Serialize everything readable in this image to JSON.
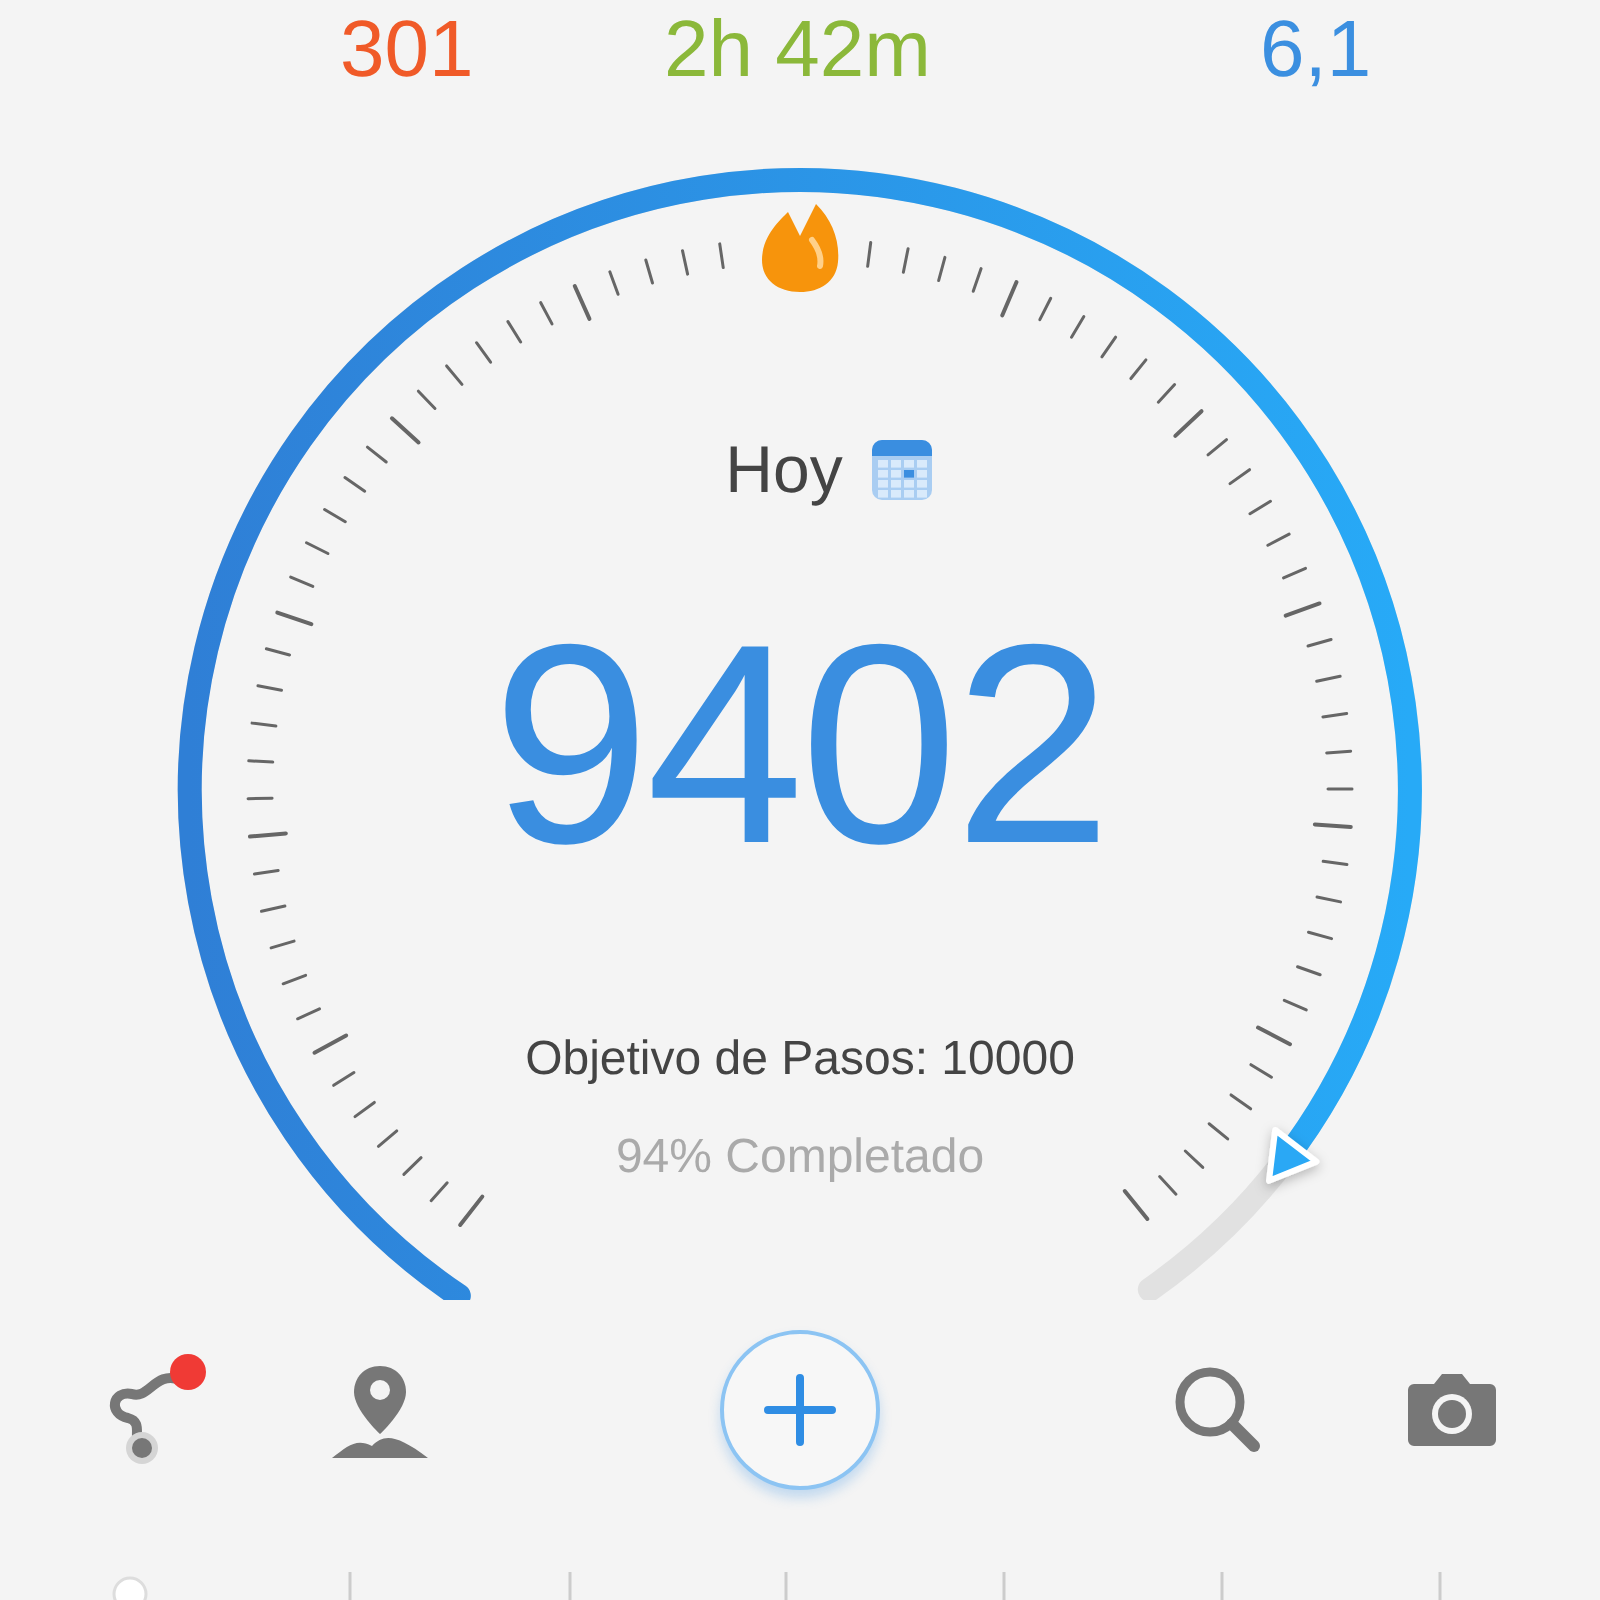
{
  "stats": [
    {
      "value": "301",
      "color": "#f05a28"
    },
    {
      "value": "2h 42m",
      "color": "#8bb83a"
    },
    {
      "value": "6,1",
      "color": "#3b8fe0"
    }
  ],
  "gauge": {
    "day_label": "Hoy",
    "steps": "9402",
    "goal": "Objetivo de Pasos: 10000",
    "completion": "94% Completado"
  },
  "toolbar": {
    "route_has_notification": true
  }
}
